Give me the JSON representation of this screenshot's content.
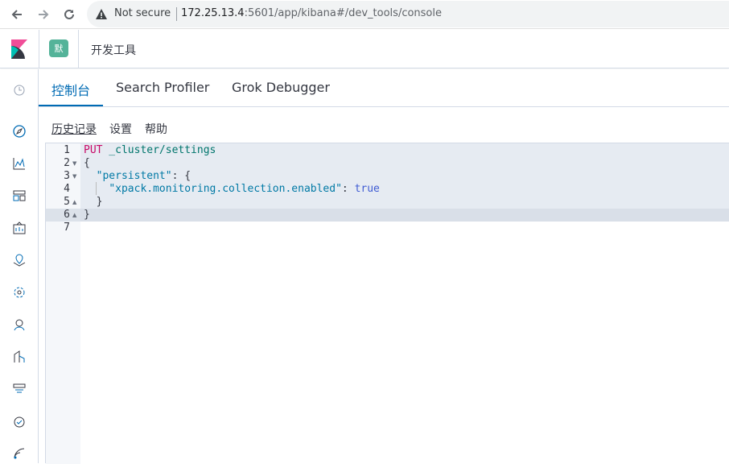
{
  "browser": {
    "security_label": "Not secure",
    "url_host": "172.25.13.4",
    "url_path": ":5601/app/kibana#/dev_tools/console"
  },
  "header": {
    "space_initial": "默",
    "title": "开发工具"
  },
  "tabs": [
    {
      "label": "控制台",
      "active": true
    },
    {
      "label": "Search Profiler",
      "active": false
    },
    {
      "label": "Grok Debugger",
      "active": false
    }
  ],
  "toolbar": {
    "history_label": "历史记录",
    "settings_label": "设置",
    "help_label": "帮助"
  },
  "editor": {
    "line_numbers": [
      "1",
      "2",
      "3",
      "4",
      "5",
      "6",
      "7"
    ],
    "method": "PUT",
    "endpoint": " _cluster/settings",
    "lines": {
      "l2": "{",
      "l3_key": "\"persistent\"",
      "l3_rest": ": {",
      "l4_key": "\"xpack.monitoring.collection.enabled\"",
      "l4_colon": ": ",
      "l4_value": "true",
      "l5": "}",
      "l6": "}"
    },
    "active_line": 6
  },
  "nav_icons": [
    "recent-icon",
    "discover-icon",
    "visualize-icon",
    "dashboard-icon",
    "canvas-icon",
    "maps-icon",
    "ml-icon",
    "graph-icon",
    "apm-icon",
    "logs-icon",
    "uptime-icon",
    "monitoring-icon"
  ],
  "colors": {
    "accent": "#006bb4",
    "space_badge": "#54b399",
    "method": "#c80a68",
    "endpoint": "#00756c",
    "key": "#0079a5",
    "boolean": "#3f5bd3"
  }
}
